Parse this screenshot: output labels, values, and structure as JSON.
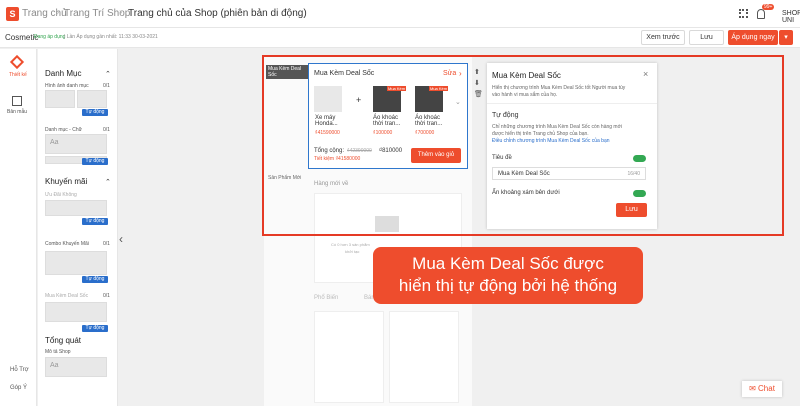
{
  "topbar": {
    "home": "Trang chủ",
    "decor": "Trang Trí Shop",
    "page": "Trang chủ của Shop (phiên bản di động)",
    "badge": "99+",
    "user": "SHOPEE UNI"
  },
  "subbar": {
    "shop": "Cosmetic",
    "status": "Đang áp dụng",
    "saved": "| Lần Áp dụng gần nhất: 11:33 30-03-2021",
    "preview": "Xem trước",
    "save": "Lưu",
    "apply": "Áp dụng ngay"
  },
  "rail": {
    "decorate": "Thiết kế",
    "template": "Bản mẫu",
    "help": "Hỗ Trợ",
    "feedback": "Góp Ý"
  },
  "panel": {
    "cat_title": "Danh Mục",
    "img_cat": "Hình ảnh danh mục",
    "cat_text": "Danh mục - Chữ",
    "count1": "0/1",
    "count2": "0/1",
    "auto": "Tự động",
    "promo_title": "Khuyến mãi",
    "voucher": "Ưu Đãi Không",
    "combo": "Combo Khuyến Mãi",
    "combo_count": "0/1",
    "bundle": "Mua Kèm Deal Sốc",
    "bundle_count": "0/1",
    "general": "Tổng quát",
    "shop_desc": "Mô tả Shop",
    "aa": "Aa"
  },
  "phone": {
    "left_tag": "Mua Kèm Deal Sốc",
    "products_tag": "Sản Phẩm Mới",
    "new_items": "Hàng mới về",
    "empty_text": "Có 0 hơn 3 sản phẩm",
    "empty_text2": "khởi tạo",
    "popular": "Phổ Biến",
    "best": "Bán Chạy"
  },
  "widget": {
    "title": "Mua Kèm Deal Sốc",
    "edit": "Sửa",
    "p1_name": "Xe máy Honda...",
    "p1_price": "₫41590000",
    "p2_name": "Áo khoác thời tran...",
    "p2_price": "₫100000",
    "p3_name": "Áo khoác thời tran...",
    "p3_price": "₫700000",
    "total_label": "Tổng cộng:",
    "total_old": "₫42390000",
    "total_new": "₫810000",
    "saving": "Tiết kiệm ₫41580000",
    "add": "Thêm vào giỏ",
    "sale_tag": "Mua Kèm"
  },
  "right": {
    "title": "Mua Kèm Deal Sốc",
    "desc": "Hiển thị chương trình Mua Kèm Deal Sốc tốt Người mua tùy vào hành vi mua sắm của họ.",
    "auto_title": "Tự động",
    "auto_desc": "Chỉ những chương trình Mua Kèm Deal Sốc còn hàng mới được hiển thị trên Trang chủ Shop của bạn.",
    "link": "Điều chỉnh chương trình Mua Kèm Deal Sốc của bạn",
    "heading": "Tiêu đề",
    "field": "Mua Kèm Deal Sốc",
    "counter": "16/40",
    "hide": "Ẩn khoảng xám bên dưới",
    "save": "Lưu"
  },
  "callout": {
    "line1": "Mua Kèm Deal Sốc được",
    "line2": "hiển thị tự động bởi hệ thống"
  },
  "chat": "Chat"
}
